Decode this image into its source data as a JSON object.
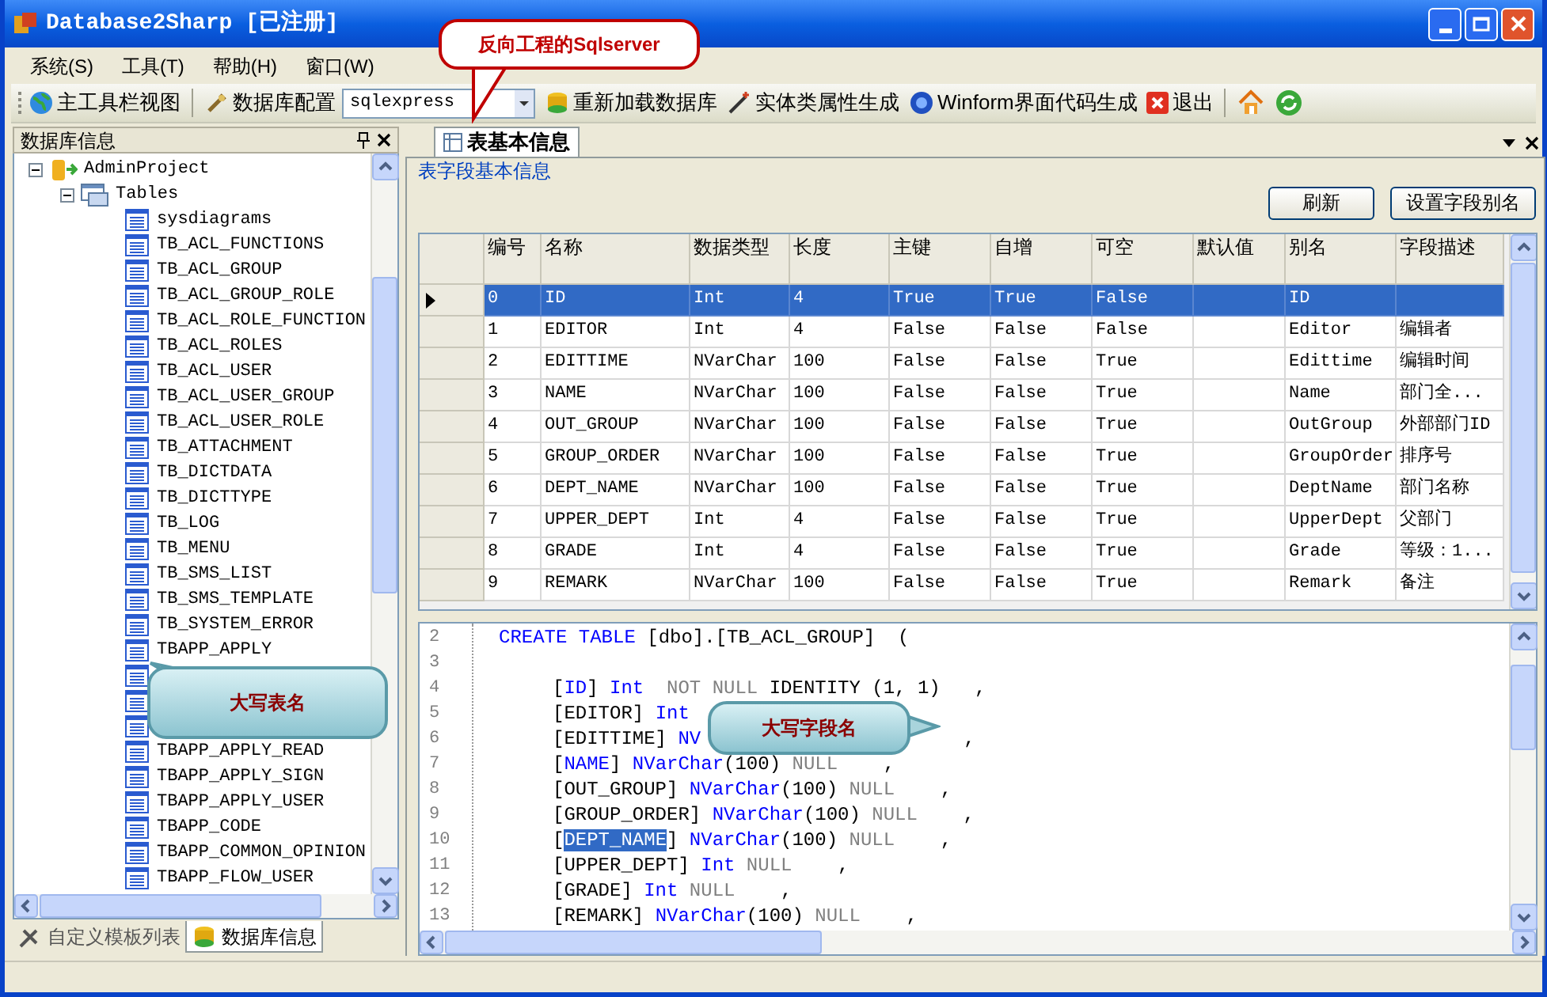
{
  "window": {
    "title": "Database2Sharp [已注册]"
  },
  "menu": [
    "系统(S)",
    "工具(T)",
    "帮助(H)",
    "窗口(W)"
  ],
  "toolbar": [
    {
      "kind": "button",
      "label": "主工具栏视图"
    },
    {
      "kind": "separator"
    },
    {
      "kind": "button",
      "label": "数据库配置"
    },
    {
      "kind": "combo",
      "value": "sqlexpress"
    },
    {
      "kind": "button",
      "label": "重新加载数据库"
    },
    {
      "kind": "button",
      "label": "实体类属性生成"
    },
    {
      "kind": "button",
      "label": "Winform界面代码生成"
    },
    {
      "kind": "button",
      "label": "退出"
    },
    {
      "kind": "separator"
    },
    {
      "kind": "icon"
    },
    {
      "kind": "icon"
    }
  ],
  "left_panel": {
    "title": "数据库信息",
    "tree": {
      "label": "AdminProject",
      "expanded": true,
      "children": [
        {
          "label": "Tables",
          "expanded": true,
          "children": [
            {
              "kind": "table",
              "label": "sysdiagrams"
            },
            {
              "kind": "table",
              "label": "TB_ACL_FUNCTIONS"
            },
            {
              "kind": "table",
              "label": "TB_ACL_GROUP"
            },
            {
              "kind": "table",
              "label": "TB_ACL_GROUP_ROLE"
            },
            {
              "kind": "table",
              "label": "TB_ACL_ROLE_FUNCTION"
            },
            {
              "kind": "table",
              "label": "TB_ACL_ROLES"
            },
            {
              "kind": "table",
              "label": "TB_ACL_USER"
            },
            {
              "kind": "table",
              "label": "TB_ACL_USER_GROUP"
            },
            {
              "kind": "table",
              "label": "TB_ACL_USER_ROLE"
            },
            {
              "kind": "table",
              "label": "TB_ATTACHMENT"
            },
            {
              "kind": "table",
              "label": "TB_DICTDATA"
            },
            {
              "kind": "table",
              "label": "TB_DICTTYPE"
            },
            {
              "kind": "table",
              "label": "TB_LOG"
            },
            {
              "kind": "table",
              "label": "TB_MENU"
            },
            {
              "kind": "table",
              "label": "TB_SMS_LIST"
            },
            {
              "kind": "table",
              "label": "TB_SMS_TEMPLATE"
            },
            {
              "kind": "table",
              "label": "TB_SYSTEM_ERROR"
            },
            {
              "kind": "table",
              "label": "TBAPP_APPLY"
            },
            {
              "kind": "covered"
            },
            {
              "kind": "covered"
            },
            {
              "kind": "covered"
            },
            {
              "kind": "table",
              "label": "TBAPP_APPLY_READ"
            },
            {
              "kind": "table",
              "label": "TBAPP_APPLY_SIGN"
            },
            {
              "kind": "table",
              "label": "TBAPP_APPLY_USER"
            },
            {
              "kind": "table",
              "label": "TBAPP_CODE"
            },
            {
              "kind": "table",
              "label": "TBAPP_COMMON_OPINION"
            },
            {
              "kind": "table",
              "label": "TBAPP_FLOW_USER"
            }
          ]
        }
      ]
    },
    "tabs": [
      {
        "label": "自定义模板列表",
        "selected": false
      },
      {
        "label": "数据库信息",
        "selected": true
      }
    ]
  },
  "document_tabs": [
    {
      "label": "表基本信息",
      "selected": true
    }
  ],
  "section_label": "表字段基本信息",
  "buttons": [
    "刷新",
    "设置字段别名"
  ],
  "grid": {
    "columns": [
      "编号",
      "名称",
      "数据类型",
      "长度",
      "主键",
      "自增",
      "可空",
      "默认值",
      "别名",
      "字段描述"
    ],
    "rows": [
      {
        "selected": true,
        "cells": [
          "0",
          "ID",
          "Int",
          "4",
          "True",
          "True",
          "False",
          "",
          "ID",
          ""
        ]
      },
      {
        "selected": false,
        "cells": [
          "1",
          "EDITOR",
          "Int",
          "4",
          "False",
          "False",
          "False",
          "",
          "Editor",
          "编辑者"
        ]
      },
      {
        "selected": false,
        "cells": [
          "2",
          "EDITTIME",
          "NVarChar",
          "100",
          "False",
          "False",
          "True",
          "",
          "Edittime",
          "编辑时间"
        ]
      },
      {
        "selected": false,
        "cells": [
          "3",
          "NAME",
          "NVarChar",
          "100",
          "False",
          "False",
          "True",
          "",
          "Name",
          "部门全..."
        ]
      },
      {
        "selected": false,
        "cells": [
          "4",
          "OUT_GROUP",
          "NVarChar",
          "100",
          "False",
          "False",
          "True",
          "",
          "OutGroup",
          "外部部门ID"
        ]
      },
      {
        "selected": false,
        "cells": [
          "5",
          "GROUP_ORDER",
          "NVarChar",
          "100",
          "False",
          "False",
          "True",
          "",
          "GroupOrder",
          "排序号"
        ]
      },
      {
        "selected": false,
        "cells": [
          "6",
          "DEPT_NAME",
          "NVarChar",
          "100",
          "False",
          "False",
          "True",
          "",
          "DeptName",
          "部门名称"
        ]
      },
      {
        "selected": false,
        "cells": [
          "7",
          "UPPER_DEPT",
          "Int",
          "4",
          "False",
          "False",
          "True",
          "",
          "UpperDept",
          "父部门"
        ]
      },
      {
        "selected": false,
        "cells": [
          "8",
          "GRADE",
          "Int",
          "4",
          "False",
          "False",
          "True",
          "",
          "Grade",
          "等级：1..."
        ]
      },
      {
        "selected": false,
        "cells": [
          "9",
          "REMARK",
          "NVarChar",
          "100",
          "False",
          "False",
          "True",
          "",
          "Remark",
          "备注"
        ]
      }
    ]
  },
  "code": {
    "lines": [
      {
        "number": "2",
        "indent": false,
        "tokens": [
          {
            "kind": "keyword",
            "text": "CREATE TABLE"
          },
          {
            "kind": "plain",
            "text": " [dbo].[TB_ACL_GROUP]  ("
          }
        ]
      },
      {
        "number": "3"
      },
      {
        "number": "4",
        "indent": true,
        "tokens": [
          {
            "kind": "plain",
            "text": "["
          },
          {
            "kind": "keyword",
            "text": "ID"
          },
          {
            "kind": "plain",
            "text": "] "
          },
          {
            "kind": "keyword",
            "text": "Int"
          },
          {
            "kind": "muted",
            "text": "  NOT NULL "
          },
          {
            "kind": "plain",
            "text": "IDENTITY (1, 1)   ,"
          }
        ]
      },
      {
        "number": "5",
        "indent": true,
        "tokens": [
          {
            "kind": "plain",
            "text": "[EDITOR] "
          },
          {
            "kind": "keyword",
            "text": "Int"
          }
        ]
      },
      {
        "number": "6",
        "indent": true,
        "tokens": [
          {
            "kind": "plain",
            "text": "[EDITTIME] "
          },
          {
            "kind": "keyword",
            "text": "NV"
          },
          {
            "kind": "trailing",
            "text": ","
          }
        ]
      },
      {
        "number": "7",
        "indent": true,
        "tokens": [
          {
            "kind": "plain",
            "text": "["
          },
          {
            "kind": "keyword",
            "text": "NAME"
          },
          {
            "kind": "plain",
            "text": "] "
          },
          {
            "kind": "keyword",
            "text": "NVarChar"
          },
          {
            "kind": "plain",
            "text": "(100) "
          },
          {
            "kind": "muted",
            "text": "NULL"
          },
          {
            "kind": "plain",
            "text": "    ,"
          }
        ]
      },
      {
        "number": "8",
        "indent": true,
        "tokens": [
          {
            "kind": "plain",
            "text": "[OUT_GROUP] "
          },
          {
            "kind": "keyword",
            "text": "NVarChar"
          },
          {
            "kind": "plain",
            "text": "(100) "
          },
          {
            "kind": "muted",
            "text": "NULL"
          },
          {
            "kind": "plain",
            "text": "    ,"
          }
        ]
      },
      {
        "number": "9",
        "indent": true,
        "tokens": [
          {
            "kind": "plain",
            "text": "[GROUP_ORDER] "
          },
          {
            "kind": "keyword",
            "text": "NVarChar"
          },
          {
            "kind": "plain",
            "text": "(100) "
          },
          {
            "kind": "muted",
            "text": "NULL"
          },
          {
            "kind": "plain",
            "text": "    ,"
          }
        ]
      },
      {
        "number": "10",
        "indent": true,
        "tokens": [
          {
            "kind": "plain",
            "text": "["
          },
          {
            "kind": "selected",
            "text": "DEPT_NAME"
          },
          {
            "kind": "plain",
            "text": "] "
          },
          {
            "kind": "keyword",
            "text": "NVarChar"
          },
          {
            "kind": "plain",
            "text": "(100) "
          },
          {
            "kind": "muted",
            "text": "NULL"
          },
          {
            "kind": "plain",
            "text": "    ,"
          }
        ]
      },
      {
        "number": "11",
        "indent": true,
        "tokens": [
          {
            "kind": "plain",
            "text": "[UPPER_DEPT] "
          },
          {
            "kind": "keyword",
            "text": "Int"
          },
          {
            "kind": "muted",
            "text": " NULL"
          },
          {
            "kind": "plain",
            "text": "    ,"
          }
        ]
      },
      {
        "number": "12",
        "indent": true,
        "tokens": [
          {
            "kind": "plain",
            "text": "[GRADE] "
          },
          {
            "kind": "keyword",
            "text": "Int"
          },
          {
            "kind": "muted",
            "text": " NULL"
          },
          {
            "kind": "plain",
            "text": "    ,"
          }
        ]
      },
      {
        "number": "13",
        "indent": true,
        "tokens": [
          {
            "kind": "plain",
            "text": "[REMARK] "
          },
          {
            "kind": "keyword",
            "text": "NVarChar"
          },
          {
            "kind": "plain",
            "text": "(100) "
          },
          {
            "kind": "muted",
            "text": "NULL"
          },
          {
            "kind": "plain",
            "text": "    ,"
          }
        ]
      }
    ]
  },
  "callouts": [
    {
      "kind": "red",
      "text": "反向工程的Sqlserver"
    },
    {
      "kind": "teal",
      "text": "大写表名"
    },
    {
      "kind": "teal",
      "text": "大写字段名"
    }
  ]
}
